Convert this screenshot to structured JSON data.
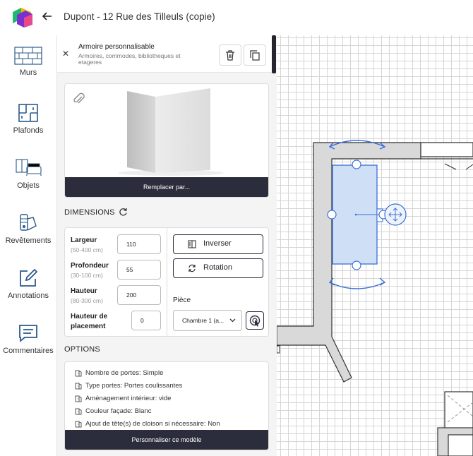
{
  "header": {
    "title": "Dupont - 12 Rue des Tilleuls (copie)"
  },
  "rail": {
    "items": [
      {
        "label": "Murs",
        "icon": "wall-icon"
      },
      {
        "label": "Plafonds",
        "icon": "ceiling-icon"
      },
      {
        "label": "Objets",
        "icon": "objects-icon"
      },
      {
        "label": "Revêtements",
        "icon": "swatch-icon"
      },
      {
        "label": "Annotations",
        "icon": "annotation-icon"
      },
      {
        "label": "Commentaires",
        "icon": "comment-icon"
      }
    ]
  },
  "object": {
    "title": "Armoire personnalisable",
    "subtitle": "Armoires, commodes, bibliotheques et etageres",
    "replace_label": "Remplacer par..."
  },
  "dimensions": {
    "heading": "DIMENSIONS",
    "fields": [
      {
        "label": "Largeur",
        "range": "(50-400 cm)",
        "value": "110"
      },
      {
        "label": "Profondeur",
        "range": "(30-100 cm)",
        "value": "55"
      },
      {
        "label": "Hauteur",
        "range": "(80-300 cm)",
        "value": "200"
      },
      {
        "label": "Hauteur de placement",
        "label_line1": "Hauteur de",
        "label_line2": "placement",
        "value": "0"
      }
    ],
    "invert_label": "Inverser",
    "rotate_label": "Rotation",
    "room_label": "Pièce",
    "room_value": "Chambre 1 (a..."
  },
  "options": {
    "heading": "OPTIONS",
    "items": [
      "Nombre de portes: Simple",
      "Type portes: Portes coulissantes",
      "Aménagement intérieur: vide",
      "Couleur façade: Blanc",
      "Ajout de tête(s) de cloison si nécessaire: Non"
    ],
    "customize_label": "Personnaliser ce modèle"
  },
  "colors": {
    "accent": "#2b2d3c",
    "selection": "#3a6fd8",
    "wall": "#d9d9d9"
  }
}
